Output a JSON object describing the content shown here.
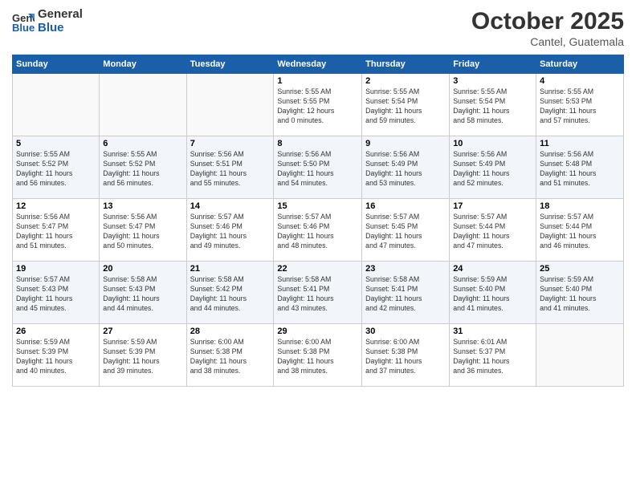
{
  "header": {
    "logo_line1": "General",
    "logo_line2": "Blue",
    "month": "October 2025",
    "location": "Cantel, Guatemala"
  },
  "weekdays": [
    "Sunday",
    "Monday",
    "Tuesday",
    "Wednesday",
    "Thursday",
    "Friday",
    "Saturday"
  ],
  "weeks": [
    [
      {
        "day": "",
        "info": ""
      },
      {
        "day": "",
        "info": ""
      },
      {
        "day": "",
        "info": ""
      },
      {
        "day": "1",
        "info": "Sunrise: 5:55 AM\nSunset: 5:55 PM\nDaylight: 12 hours\nand 0 minutes."
      },
      {
        "day": "2",
        "info": "Sunrise: 5:55 AM\nSunset: 5:54 PM\nDaylight: 11 hours\nand 59 minutes."
      },
      {
        "day": "3",
        "info": "Sunrise: 5:55 AM\nSunset: 5:54 PM\nDaylight: 11 hours\nand 58 minutes."
      },
      {
        "day": "4",
        "info": "Sunrise: 5:55 AM\nSunset: 5:53 PM\nDaylight: 11 hours\nand 57 minutes."
      }
    ],
    [
      {
        "day": "5",
        "info": "Sunrise: 5:55 AM\nSunset: 5:52 PM\nDaylight: 11 hours\nand 56 minutes."
      },
      {
        "day": "6",
        "info": "Sunrise: 5:55 AM\nSunset: 5:52 PM\nDaylight: 11 hours\nand 56 minutes."
      },
      {
        "day": "7",
        "info": "Sunrise: 5:56 AM\nSunset: 5:51 PM\nDaylight: 11 hours\nand 55 minutes."
      },
      {
        "day": "8",
        "info": "Sunrise: 5:56 AM\nSunset: 5:50 PM\nDaylight: 11 hours\nand 54 minutes."
      },
      {
        "day": "9",
        "info": "Sunrise: 5:56 AM\nSunset: 5:49 PM\nDaylight: 11 hours\nand 53 minutes."
      },
      {
        "day": "10",
        "info": "Sunrise: 5:56 AM\nSunset: 5:49 PM\nDaylight: 11 hours\nand 52 minutes."
      },
      {
        "day": "11",
        "info": "Sunrise: 5:56 AM\nSunset: 5:48 PM\nDaylight: 11 hours\nand 51 minutes."
      }
    ],
    [
      {
        "day": "12",
        "info": "Sunrise: 5:56 AM\nSunset: 5:47 PM\nDaylight: 11 hours\nand 51 minutes."
      },
      {
        "day": "13",
        "info": "Sunrise: 5:56 AM\nSunset: 5:47 PM\nDaylight: 11 hours\nand 50 minutes."
      },
      {
        "day": "14",
        "info": "Sunrise: 5:57 AM\nSunset: 5:46 PM\nDaylight: 11 hours\nand 49 minutes."
      },
      {
        "day": "15",
        "info": "Sunrise: 5:57 AM\nSunset: 5:46 PM\nDaylight: 11 hours\nand 48 minutes."
      },
      {
        "day": "16",
        "info": "Sunrise: 5:57 AM\nSunset: 5:45 PM\nDaylight: 11 hours\nand 47 minutes."
      },
      {
        "day": "17",
        "info": "Sunrise: 5:57 AM\nSunset: 5:44 PM\nDaylight: 11 hours\nand 47 minutes."
      },
      {
        "day": "18",
        "info": "Sunrise: 5:57 AM\nSunset: 5:44 PM\nDaylight: 11 hours\nand 46 minutes."
      }
    ],
    [
      {
        "day": "19",
        "info": "Sunrise: 5:57 AM\nSunset: 5:43 PM\nDaylight: 11 hours\nand 45 minutes."
      },
      {
        "day": "20",
        "info": "Sunrise: 5:58 AM\nSunset: 5:43 PM\nDaylight: 11 hours\nand 44 minutes."
      },
      {
        "day": "21",
        "info": "Sunrise: 5:58 AM\nSunset: 5:42 PM\nDaylight: 11 hours\nand 44 minutes."
      },
      {
        "day": "22",
        "info": "Sunrise: 5:58 AM\nSunset: 5:41 PM\nDaylight: 11 hours\nand 43 minutes."
      },
      {
        "day": "23",
        "info": "Sunrise: 5:58 AM\nSunset: 5:41 PM\nDaylight: 11 hours\nand 42 minutes."
      },
      {
        "day": "24",
        "info": "Sunrise: 5:59 AM\nSunset: 5:40 PM\nDaylight: 11 hours\nand 41 minutes."
      },
      {
        "day": "25",
        "info": "Sunrise: 5:59 AM\nSunset: 5:40 PM\nDaylight: 11 hours\nand 41 minutes."
      }
    ],
    [
      {
        "day": "26",
        "info": "Sunrise: 5:59 AM\nSunset: 5:39 PM\nDaylight: 11 hours\nand 40 minutes."
      },
      {
        "day": "27",
        "info": "Sunrise: 5:59 AM\nSunset: 5:39 PM\nDaylight: 11 hours\nand 39 minutes."
      },
      {
        "day": "28",
        "info": "Sunrise: 6:00 AM\nSunset: 5:38 PM\nDaylight: 11 hours\nand 38 minutes."
      },
      {
        "day": "29",
        "info": "Sunrise: 6:00 AM\nSunset: 5:38 PM\nDaylight: 11 hours\nand 38 minutes."
      },
      {
        "day": "30",
        "info": "Sunrise: 6:00 AM\nSunset: 5:38 PM\nDaylight: 11 hours\nand 37 minutes."
      },
      {
        "day": "31",
        "info": "Sunrise: 6:01 AM\nSunset: 5:37 PM\nDaylight: 11 hours\nand 36 minutes."
      },
      {
        "day": "",
        "info": ""
      }
    ]
  ]
}
